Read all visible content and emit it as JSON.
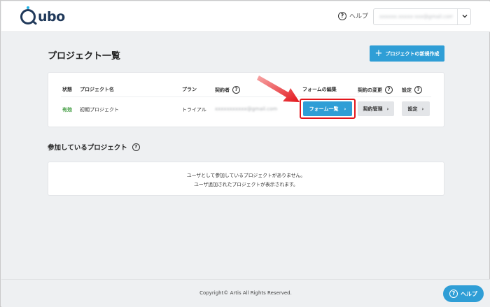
{
  "header": {
    "logo_text": "ubo",
    "help_label": "ヘルプ",
    "account_email": "xxxxxx.xxxxx-xxx@gmail.com"
  },
  "main": {
    "page_title": "プロジェクト一覧",
    "new_project_label": "プロジェクトの新規作成",
    "projects_table": {
      "headers": {
        "status": "状態",
        "name": "プロジェクト名",
        "plan": "プラン",
        "contractor": "契約者",
        "form_edit": "フォームの編集",
        "contract_change": "契約の変更",
        "settings": "設定"
      },
      "rows": [
        {
          "status": "有効",
          "name": "初期プロジェクト",
          "plan": "トライアル",
          "contractor_email": "xxxxxxxxxxx@gmail.com",
          "form_button": "フォーム一覧",
          "contract_button": "契約管理",
          "settings_button": "設定"
        }
      ]
    },
    "joined_title": "参加しているプロジェクト",
    "joined_empty": [
      "ユーザとして参加しているプロジェクトがありません。",
      "ユーザ追加されたプロジェクトが表示されます。"
    ]
  },
  "footer": {
    "copyright": "Copyright© Artis All Rights Reserved."
  },
  "help_button_label": "ヘルプ",
  "colors": {
    "accent": "#2f9ed6",
    "brand": "#20395a",
    "highlight": "#e3161c",
    "active_status": "#3c9a3c"
  }
}
